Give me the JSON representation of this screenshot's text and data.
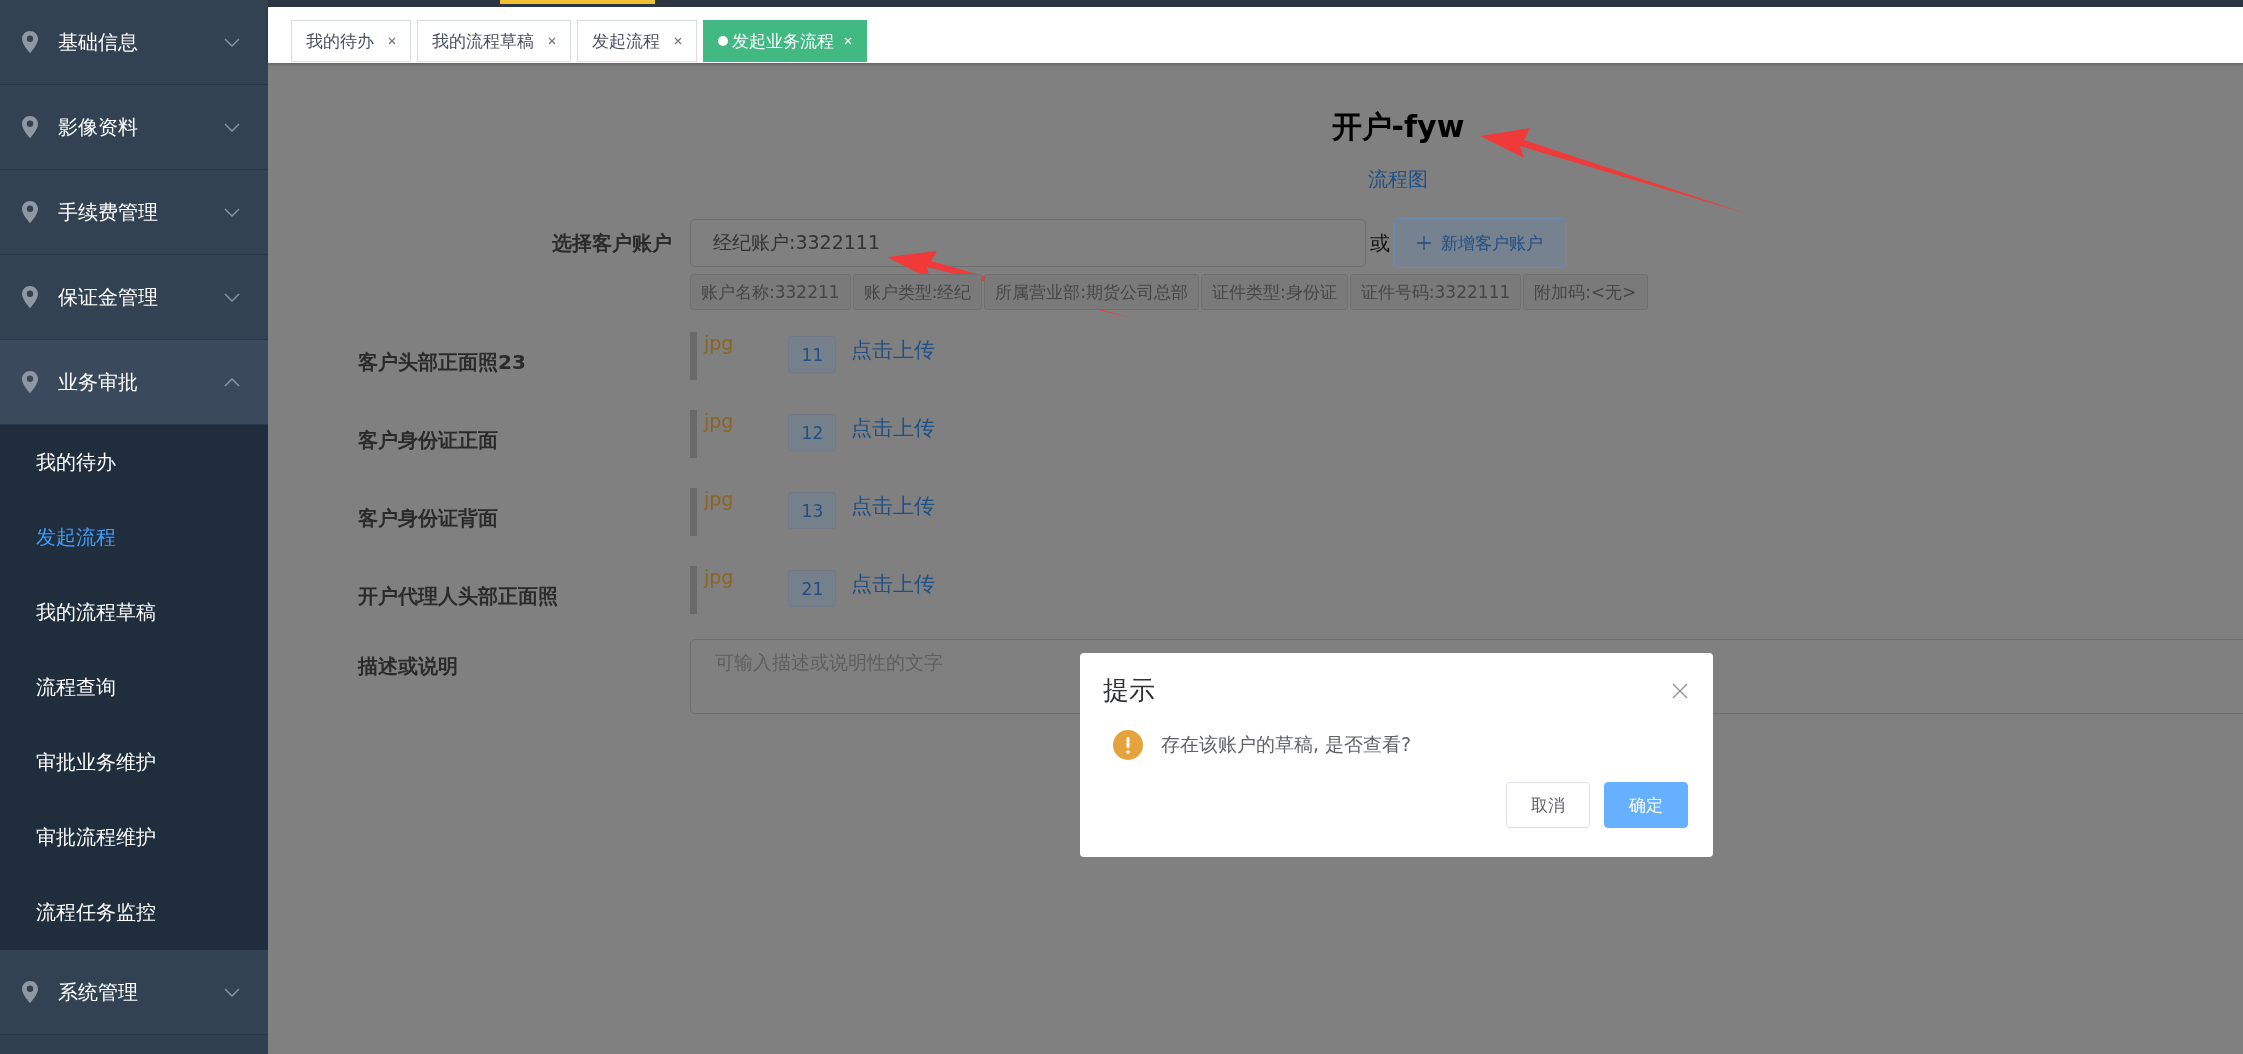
{
  "sidebar": {
    "groups": [
      {
        "label": "基础信息",
        "expanded": false
      },
      {
        "label": "影像资料",
        "expanded": false
      },
      {
        "label": "手续费管理",
        "expanded": false
      },
      {
        "label": "保证金管理",
        "expanded": false
      },
      {
        "label": "业务审批",
        "expanded": true,
        "children": [
          {
            "label": "我的待办",
            "selected": false
          },
          {
            "label": "发起流程",
            "selected": true
          },
          {
            "label": "我的流程草稿",
            "selected": false
          },
          {
            "label": "流程查询",
            "selected": false
          },
          {
            "label": "审批业务维护",
            "selected": false
          },
          {
            "label": "审批流程维护",
            "selected": false
          },
          {
            "label": "流程任务监控",
            "selected": false
          }
        ]
      },
      {
        "label": "系统管理",
        "expanded": false
      }
    ]
  },
  "tabs": [
    {
      "label": "我的待办",
      "selected": false
    },
    {
      "label": "我的流程草稿",
      "selected": false
    },
    {
      "label": "发起流程",
      "selected": false
    },
    {
      "label": "发起业务流程",
      "selected": true
    }
  ],
  "page": {
    "title": "开户-fyw",
    "link": "流程图"
  },
  "account": {
    "label": "选择客户账户",
    "value": "经纪账户:3322111",
    "or": "或",
    "add_button": "新增客户账户",
    "tags": [
      "账户名称:332211",
      "账户类型:经纪",
      "所属营业部:期货公司总部",
      "证件类型:身份证",
      "证件号码:3322111",
      "附加码:<无>"
    ]
  },
  "uploads": [
    {
      "label": "客户头部正面照23",
      "file_type": "jpg",
      "count": "11",
      "action": "点击上传"
    },
    {
      "label": "客户身份证正面",
      "file_type": "jpg",
      "count": "12",
      "action": "点击上传"
    },
    {
      "label": "客户身份证背面",
      "file_type": "jpg",
      "count": "13",
      "action": "点击上传"
    },
    {
      "label": "开户代理人头部正面照",
      "file_type": "jpg",
      "count": "21",
      "action": "点击上传"
    }
  ],
  "description": {
    "label": "描述或说明",
    "placeholder": "可输入描述或说明性的文字"
  },
  "dialog": {
    "title": "提示",
    "message": "存在该账户的草稿, 是否查看?",
    "buttons": [
      {
        "label": "取消",
        "kind": "default"
      },
      {
        "label": "确定",
        "kind": "primary"
      }
    ]
  }
}
